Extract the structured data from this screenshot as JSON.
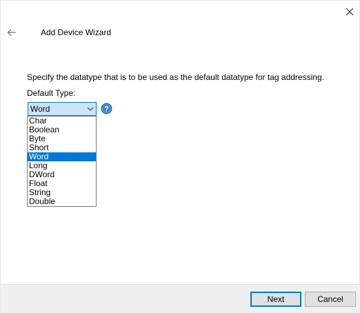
{
  "window": {
    "title": "Add Device Wizard",
    "icons": {
      "close": "close-icon",
      "back": "back-arrow-icon",
      "help": "help-icon",
      "dropdown": "chevron-down-icon"
    }
  },
  "page": {
    "description": "Specify the datatype that is to be used as the default datatype for tag addressing.",
    "field_label": "Default Type:",
    "select": {
      "value": "Word",
      "options": [
        "Char",
        "Boolean",
        "Byte",
        "Short",
        "Word",
        "Long",
        "DWord",
        "Float",
        "String",
        "Double"
      ],
      "highlighted_option": "Word"
    }
  },
  "footer": {
    "next_label": "Next",
    "cancel_label": "Cancel"
  },
  "colors": {
    "accent": "#0078d7",
    "select_bg": "#cce4f7",
    "footer_bg": "#f0f0f0",
    "help_icon": "#3a7fc4"
  }
}
